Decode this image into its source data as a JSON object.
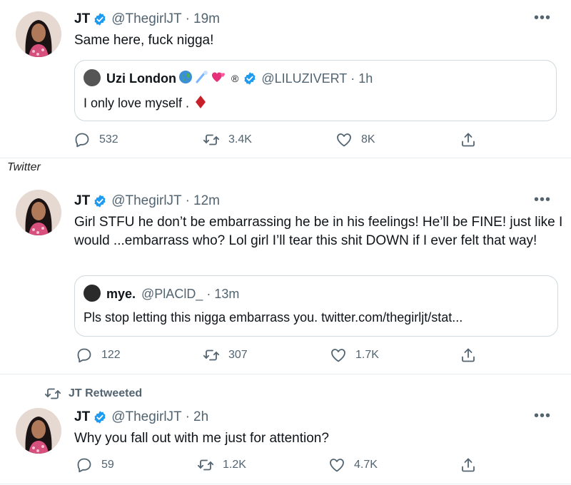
{
  "tweets": [
    {
      "author": "JT",
      "handle": "@ThegirlJT",
      "time": "19m",
      "text": "Same here, fuck nigga!",
      "quote": {
        "author": "Uzi London",
        "badge": "®",
        "handle": "@LILUZIVERT",
        "time": "1h",
        "text": "I only love myself ."
      },
      "stats": {
        "replies": "532",
        "retweets": "3.4K",
        "likes": "8K"
      }
    },
    {
      "author": "JT",
      "handle": "@ThegirlJT",
      "time": "12m",
      "text": "Girl STFU he don’t be embarrassing he be in his feelings! He’ll be FINE! just like I would ...embarrass who? Lol girl I’ll tear this shit DOWN if I ever felt that way!",
      "quote": {
        "author": "mye.",
        "handle": "@PlAClD_",
        "time": "13m",
        "text": "Pls stop letting this nigga embarrass you. twitter.com/thegirljt/stat..."
      },
      "stats": {
        "replies": "122",
        "retweets": "307",
        "likes": "1.7K"
      }
    },
    {
      "retweeted_label": "JT Retweeted",
      "author": "JT",
      "handle": "@ThegirlJT",
      "time": "2h",
      "text": "Why you fall out with me just for attention?",
      "stats": {
        "replies": "59",
        "retweets": "1.2K",
        "likes": "4.7K"
      }
    }
  ],
  "caption": "Twitter",
  "separator": "·",
  "more_glyph": "•••",
  "colors": {
    "verified": "#1d9bf0",
    "muted": "#536471",
    "border": "#cfd9de"
  },
  "icons": [
    "verified-badge-icon",
    "reply-icon",
    "retweet-icon",
    "like-icon",
    "share-icon",
    "more-icon",
    "globe-emoji",
    "comet-emoji",
    "hearts-emoji",
    "diamond-emoji"
  ]
}
